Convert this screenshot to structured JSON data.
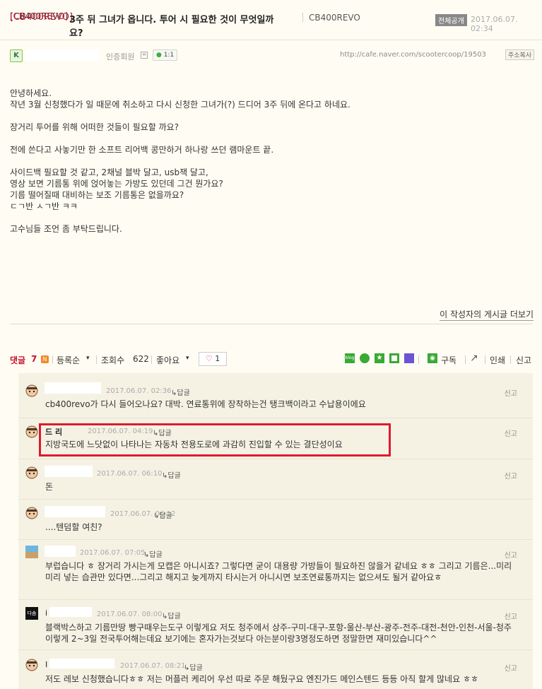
{
  "post": {
    "category": "[CB400REVO]",
    "title": "3주 뒤 그녀가 옵니다. 투어 시 필요한 것이 무엇일까요?",
    "title_line1": "3주 뒤 그녀가 옵니다. 투어 시 필요한 것이 무엇일까",
    "title_line2": "요?",
    "board": "CB400REVO",
    "visibility": "전체공개",
    "date": "2017.06.07. 02:34",
    "member_level": "인증회원",
    "talk_label": "1:1",
    "url": "http://cafe.naver.com/scootercoop/19503",
    "copy_url": "주소복사",
    "body_lines": [
      "안녕하세요.",
      "작년 3월 신청했다가 일 때문에 취소하고 다시 신청한 그녀가(?) 드디어 3주 뒤에 온다고 하네요.",
      "",
      "장거리 투어를 위해 어떠한 것들이 필요할 까요?",
      "",
      "전에 쓴다고 사놓기만 한 소프트 리어백 콩만하거 하나랑 쓰던 램마운트 끝.",
      "",
      "사이드백 필요할 것 같고, 2채널 블박 달고, usb잭 달고,",
      "영상 보면 기름통 위에 얹어놓는 가방도 있던데 그건 뭔가요?",
      "기름 떨어질때 대비하는 보조 기름통은 없을까요?",
      "ㄷㄱ반 ㅅㄱ반 ㅋㅋ",
      "",
      "고수님들 조언 좀 부탁드립니다."
    ],
    "more_posts": "이 작성자의 게시글 더보기"
  },
  "toolbar": {
    "comments_label": "댓글",
    "comments_count": "7",
    "new_badge": "N",
    "sort_label": "등록순",
    "views_label": "조회수",
    "views_count": "622",
    "like_label": "좋아요",
    "like_count": "1",
    "subscribe": "구독",
    "print": "인쇄",
    "report": "신고"
  },
  "comments": [
    {
      "name": "",
      "date": "2017.06.07. 02:36",
      "reply": "답글",
      "report": "신고",
      "text": "cb400revo가 다시 들어오나요? 대박. 연료통위에 장착하는건 탱크백이라고 수납용이에요"
    },
    {
      "name": "드      리",
      "date": "2017.06.07. 04:19",
      "reply": "답글",
      "report": "신고",
      "text": "지방국도에 느닷없이 나타나는 자동차 전용도로에 과감히 진입할 수 있는 결단성이요"
    },
    {
      "name": "",
      "date": "2017.06.07. 06:10",
      "reply": "답글",
      "report": "신고",
      "text": "돈"
    },
    {
      "name": "",
      "date": "2017.06.07. 06:12",
      "reply": "답글",
      "report": "신고",
      "text": "....텐덤할 여친?"
    },
    {
      "name": "",
      "date": "2017.06.07. 07:05",
      "reply": "답글",
      "report": "신고",
      "text": "부럽습니다 ㅎ 장거리 가시는게 모캡은 아니시죠? 그렇다면 굳이 대용량 가방들이 필요하진 않을거 같네요 ㅎㅎ 그리고 기름은...미리미리 넣는 습관만 있다면...그리고 해지고 늦게까지 타시는거 아니시면 보조연료통까지는 없으셔도 될거 같아요ㅎ"
    },
    {
      "name": "i",
      "date": "2017.06.07. 08:00",
      "reply": "답글",
      "report": "신고",
      "text": "블랙박스하고 기름만땅 빵구때우는도구 이렇게요 저도 청주에서 상주-구미-대구-포항-울산-부산-광주-전주-대전-천안-인천-서울-청주이렇게 2~3일 전국투어해는데요 보기에는 혼자가는것보다 아는분이랑3명정도하면 정말한면 재미있습니다^^"
    },
    {
      "name": "I",
      "date": "2017.06.07. 08:21",
      "reply": "답글",
      "report": "신고",
      "text": "저도 레보 신청했습니다ㅎㅎ 저는 머플러 케리어 우선 따로 주문 해뒀구요 엔진가드 메인스텐드 등등 아직 할게 많네요 ㅎㅎ"
    }
  ],
  "colors": {
    "accent_red": "#c8102e",
    "highlight_red": "#e0192d",
    "comment_bg": "#f5f2e4",
    "page_bg": "#fffdf3"
  }
}
